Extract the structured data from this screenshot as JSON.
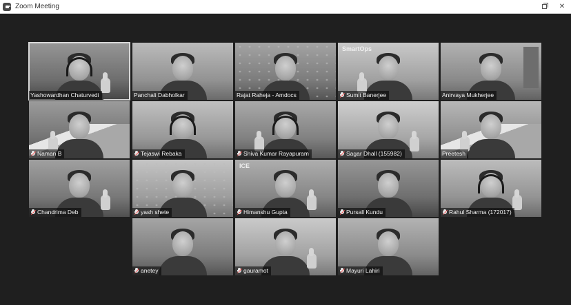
{
  "window": {
    "title": "Zoom Meeting",
    "controls": {
      "restore_icon": "restore-window-icon",
      "close_glyph": "✕"
    }
  },
  "participants": [
    {
      "name": "Yashowardhan Chaturvedi",
      "mic": "unmuted",
      "active": true
    },
    {
      "name": "Panchali Dabholkar",
      "mic": "unmuted",
      "active": false
    },
    {
      "name": "Rajat Raheja - Amdocs",
      "mic": "unmuted",
      "active": false
    },
    {
      "name": "Sumit Banerjee",
      "mic": "muted",
      "active": false
    },
    {
      "name": "Anirvaya Mukherjee",
      "mic": "unmuted",
      "active": false
    },
    {
      "name": "Naman B",
      "mic": "muted",
      "active": false
    },
    {
      "name": "Tejaswi Rebaka",
      "mic": "muted",
      "active": false
    },
    {
      "name": "Shiva Kumar Rayapuram",
      "mic": "muted",
      "active": false
    },
    {
      "name": "Sagar Dhall (155982)",
      "mic": "muted",
      "active": false
    },
    {
      "name": "Preetesh",
      "mic": "unmuted",
      "active": false
    },
    {
      "name": "Chandrima Deb",
      "mic": "muted",
      "active": false
    },
    {
      "name": "yash shete",
      "mic": "muted",
      "active": false
    },
    {
      "name": "Himanshu Gupta",
      "mic": "muted",
      "active": false
    },
    {
      "name": "Pursall Kundu",
      "mic": "muted",
      "active": false
    },
    {
      "name": "Rahul Sharma (172017)",
      "mic": "muted",
      "active": false
    },
    {
      "name": "anetey",
      "mic": "muted",
      "active": false
    },
    {
      "name": "gauramot",
      "mic": "muted",
      "active": false
    },
    {
      "name": "Mayuri Lahiri",
      "mic": "muted",
      "active": false
    }
  ],
  "tile_decor": {
    "sumit_logo": "SmartOps",
    "himanshu_logo": "ICE"
  }
}
